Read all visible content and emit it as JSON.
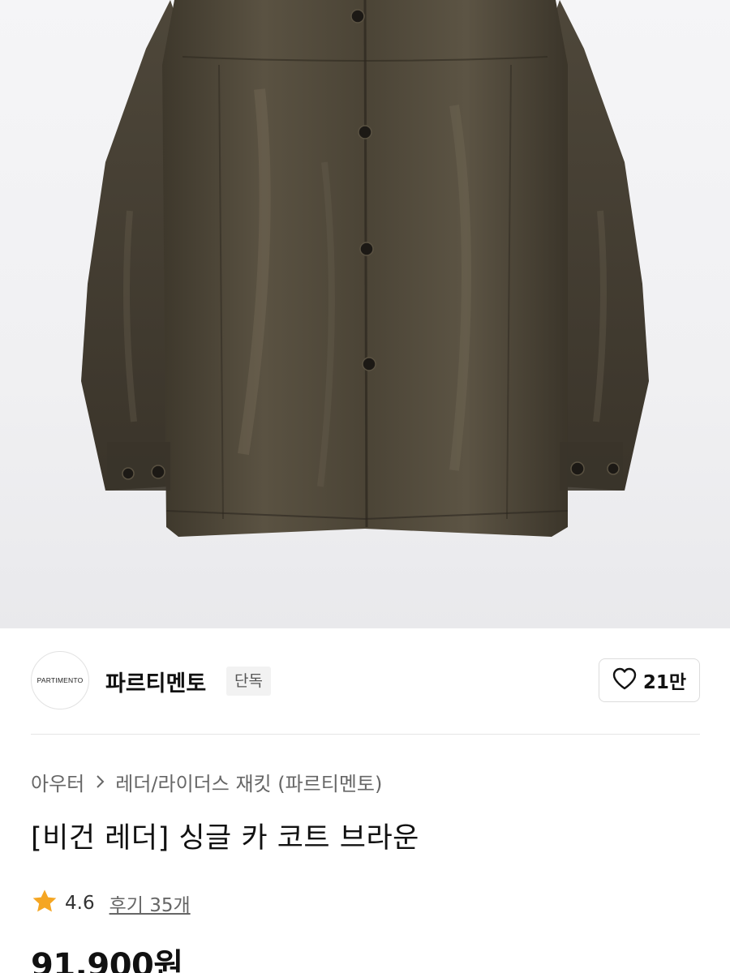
{
  "brand": {
    "logo_text": "PARTIMENTO",
    "name": "파르티멘토",
    "badge": "단독",
    "like_count": "21만"
  },
  "breadcrumb": {
    "category": "아우터",
    "subcategory": "레더/라이더스 재킷 (파르티멘토)"
  },
  "product": {
    "title": "[비건 레더] 싱글 카 코트 브라운",
    "rating": "4.6",
    "reviews": "후기 35개",
    "price": "91,900원",
    "image_subject": "brown-leather-car-coat"
  },
  "colors": {
    "coat": "#4a4334",
    "coat_shadow": "#2f2a21",
    "background": "#f0f0f2",
    "star": "#f5a623"
  },
  "icons": {
    "like": "heart-icon",
    "breadcrumb_separator": "chevron-right-icon",
    "rating": "star-icon"
  }
}
